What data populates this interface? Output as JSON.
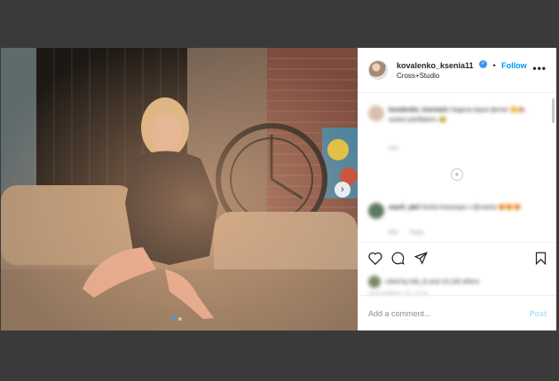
{
  "post": {
    "username": "kovalenko_ksenia11",
    "separator": "•",
    "follow_label": "Follow",
    "location": "Cross+Studio",
    "more_icon": "more-horizontal-icon"
  },
  "comments": [
    {
      "username": "kovalenko_ksenia11",
      "text": "Надела ваши фотки 😊🙈 нужно разбавить 😂",
      "time": "81w"
    },
    {
      "username": "mariii_ptel",
      "text": "Gorka krasivaya x @mariia 😍😍😍",
      "time": "80w",
      "reply": "Reply"
    }
  ],
  "likes_text": "Liked by lisb_tk and 18,136 others",
  "date_text": "DECEMBER 19, 2019",
  "add_comment": {
    "placeholder": "Add a comment...",
    "post_label": "Post"
  },
  "colors": {
    "accent": "#0095f6",
    "post_disabled": "#b2dffc",
    "backdrop": "#3a3a3a"
  }
}
